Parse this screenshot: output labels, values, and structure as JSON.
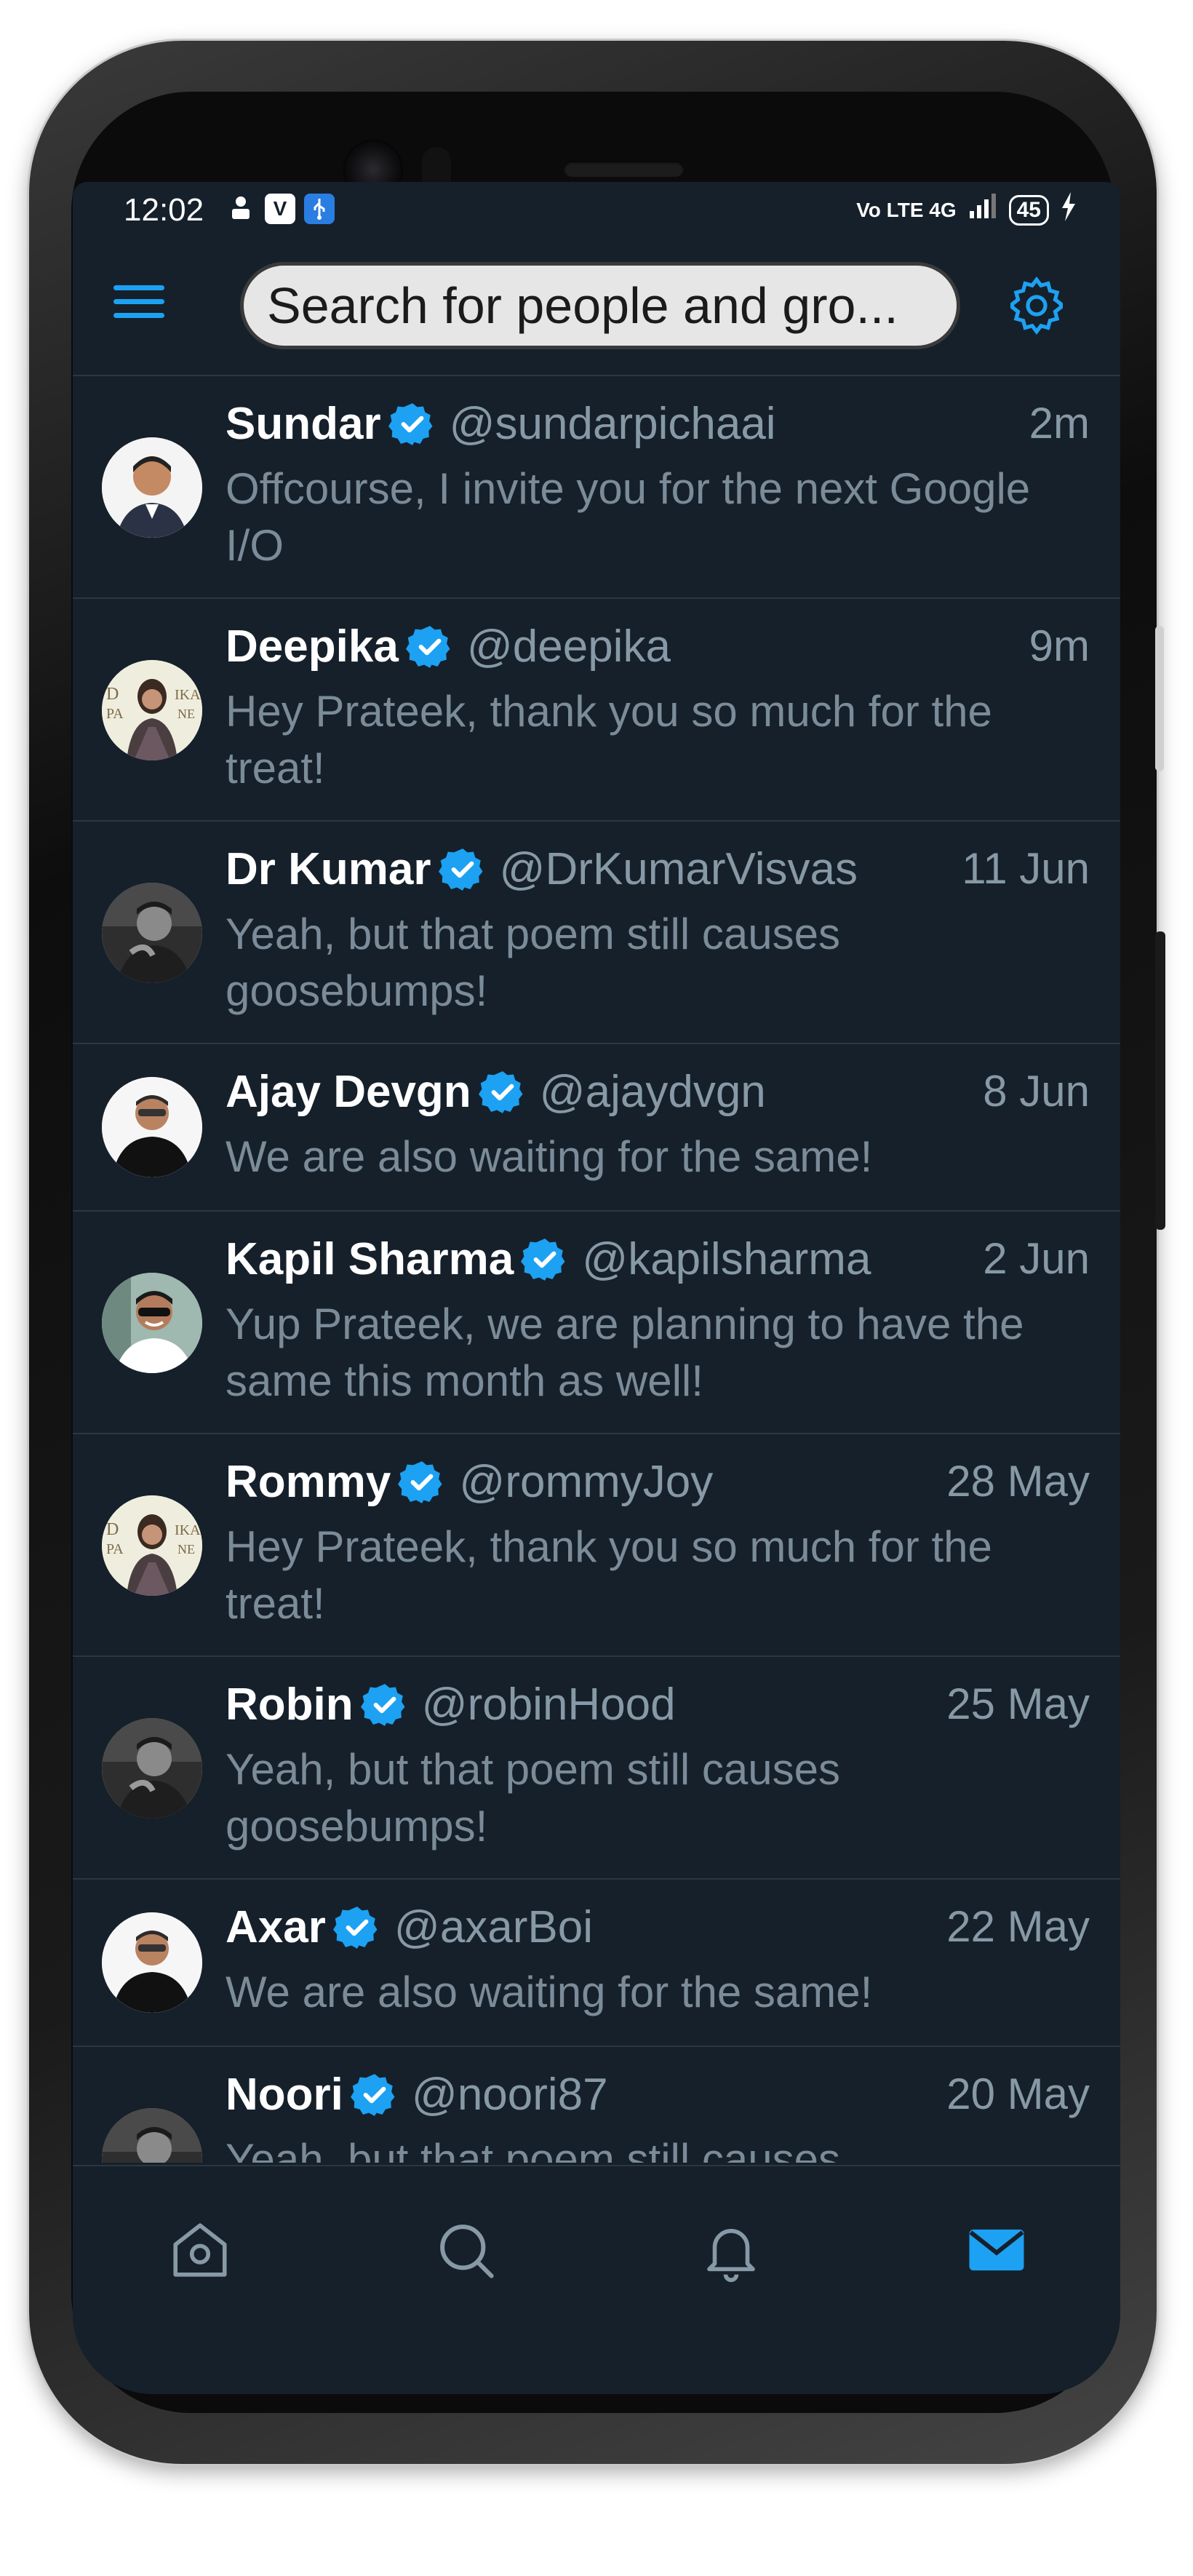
{
  "status_bar": {
    "time": "12:02",
    "network": "Vo LTE 4G",
    "battery": "45",
    "left_icons": [
      "notification-icon",
      "vlc-icon",
      "usb-icon"
    ]
  },
  "header": {
    "search_placeholder": "Search for people and gro...",
    "menu_icon": "hamburger-menu-icon",
    "settings_icon": "gear-icon"
  },
  "messages": [
    {
      "name": "Sundar",
      "handle": "@sundarpichaai",
      "time": "2m",
      "text": "Offcourse, I invite you for the next Google I/O",
      "avatar": "avatar-sundar"
    },
    {
      "name": "Deepika",
      "handle": "@deepika",
      "time": "9m",
      "text": "Hey Prateek, thank you so much for the treat!",
      "avatar": "avatar-deepika"
    },
    {
      "name": "Dr Kumar",
      "handle": "@DrKumarVisvas",
      "time": "11 Jun",
      "text": "Yeah, but that poem still causes goosebumps!",
      "avatar": "avatar-kumar"
    },
    {
      "name": "Ajay Devgn",
      "handle": "@ajaydvgn",
      "time": "8 Jun",
      "text": "We are also waiting for the same!",
      "avatar": "avatar-ajay"
    },
    {
      "name": "Kapil Sharma",
      "handle": "@kapilsharma",
      "time": "2 Jun",
      "text": "Yup Prateek, we are planning to have the same this month as well!",
      "avatar": "avatar-kapil"
    },
    {
      "name": "Rommy",
      "handle": "@rommyJoy",
      "time": "28 May",
      "text": "Hey Prateek, thank you so much for the treat!",
      "avatar": "avatar-deepika"
    },
    {
      "name": "Robin",
      "handle": "@robinHood",
      "time": "25 May",
      "text": "Yeah, but that poem still causes goosebumps!",
      "avatar": "avatar-kumar"
    },
    {
      "name": "Axar",
      "handle": "@axarBoi",
      "time": "22 May",
      "text": "We are also waiting for the same!",
      "avatar": "avatar-ajay"
    },
    {
      "name": "Noori",
      "handle": "@noori87",
      "time": "20 May",
      "text": "Yeah, but that poem still causes goosebumps!",
      "avatar": "avatar-kumar"
    }
  ],
  "bottom_nav": [
    {
      "name": "home-icon",
      "active": false
    },
    {
      "name": "search-icon",
      "active": false
    },
    {
      "name": "bell-icon",
      "active": false
    },
    {
      "name": "mail-icon",
      "active": true
    }
  ],
  "colors": {
    "background": "#15202b",
    "accent": "#1da1f2",
    "secondary_text": "#8899a6",
    "divider": "#2a3742"
  }
}
